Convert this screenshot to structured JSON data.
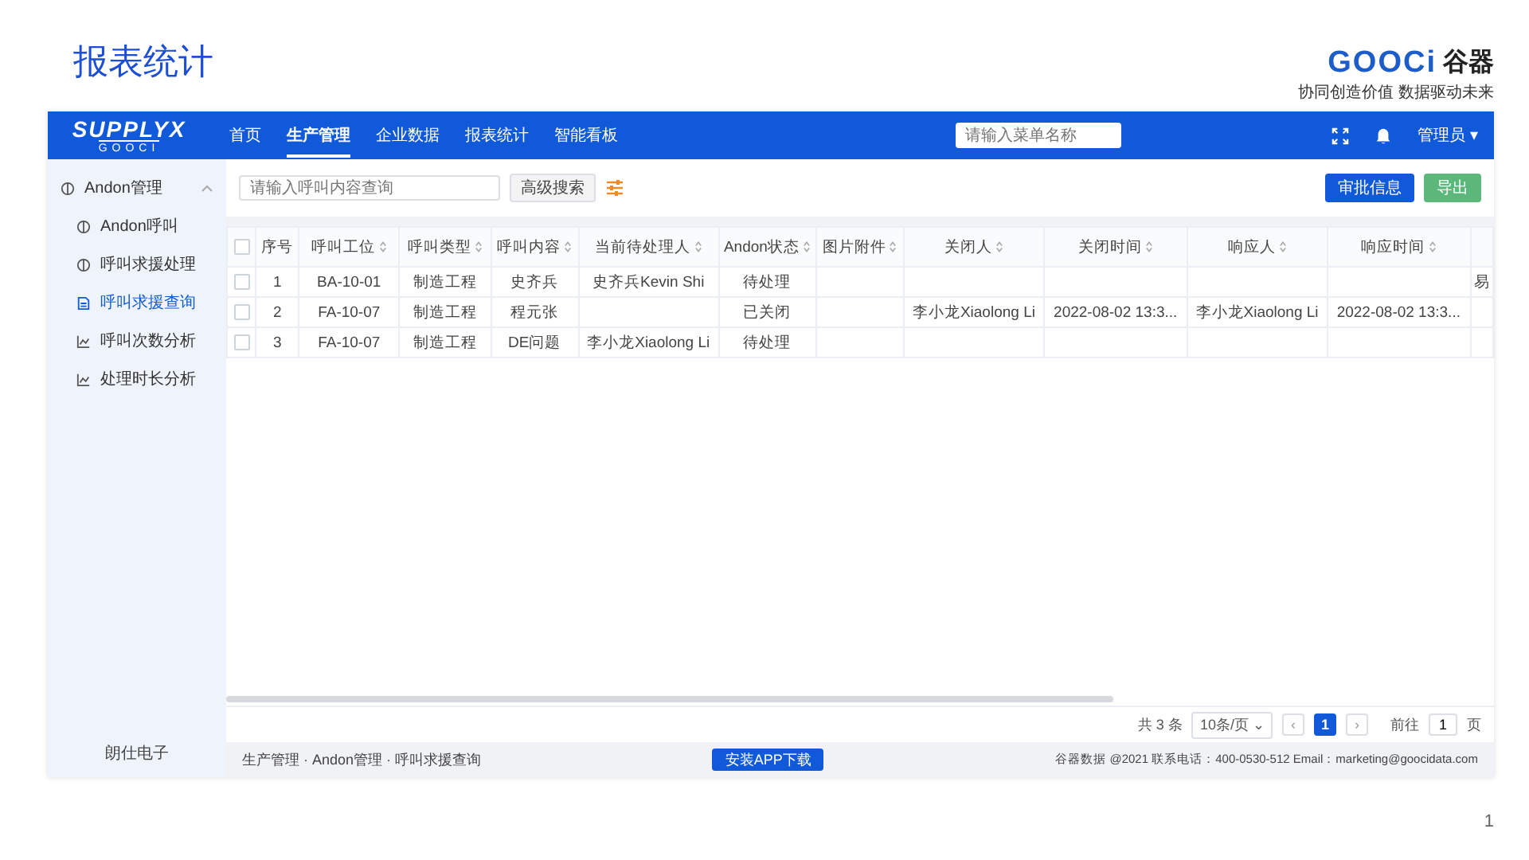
{
  "slide": {
    "title": "报表统计",
    "page_number": "1"
  },
  "logo": {
    "brand": "GOOCi",
    "brand_cn": "谷器",
    "tagline": "协同创造价值 数据驱动未来"
  },
  "app": {
    "topbar": {
      "logo_main": "SUPPLYX",
      "logo_sub": "GOOCI",
      "nav": [
        {
          "label": "首页",
          "selected": false
        },
        {
          "label": "生产管理",
          "selected": true
        },
        {
          "label": "企业数据",
          "selected": false
        },
        {
          "label": "报表统计",
          "selected": false
        },
        {
          "label": "智能看板",
          "selected": false
        }
      ],
      "search": {
        "placeholder": "请输入菜单名称"
      },
      "user": "管理员",
      "user_caret": "▾"
    },
    "sidebar": {
      "group": {
        "label": "Andon管理",
        "expanded": true,
        "children": [
          {
            "label": "Andon呼叫",
            "kind": "target",
            "selected": false
          },
          {
            "label": "呼叫求援处理",
            "kind": "target",
            "selected": false
          },
          {
            "label": "呼叫求援查询",
            "kind": "document",
            "selected": true
          },
          {
            "label": "呼叫次数分析",
            "kind": "chart",
            "selected": false
          },
          {
            "label": "处理时长分析",
            "kind": "chart",
            "selected": false
          }
        ]
      },
      "footer": "朗仕电子"
    },
    "toolbar": {
      "search": {
        "placeholder": "请输入呼叫内容查询"
      },
      "advanced": "高级搜索",
      "buttons": [
        {
          "label": "审批信息",
          "kind": "primary"
        },
        {
          "label": "导出",
          "kind": "success"
        }
      ]
    },
    "table": {
      "header_checked": false,
      "columns": [
        {
          "label": "序号",
          "sortable": false
        },
        {
          "label": "呼叫工位",
          "sortable": true
        },
        {
          "label": "呼叫类型",
          "sortable": true
        },
        {
          "label": "呼叫内容",
          "sortable": true
        },
        {
          "label": "当前待处理人",
          "sortable": true
        },
        {
          "label": "Andon状态",
          "sortable": true
        },
        {
          "label": "图片附件",
          "sortable": true
        },
        {
          "label": "关闭人",
          "sortable": true
        },
        {
          "label": "关闭时间",
          "sortable": true
        },
        {
          "label": "响应人",
          "sortable": true
        },
        {
          "label": "响应时间",
          "sortable": true
        },
        {
          "sortable": false
        }
      ],
      "rows": [
        {
          "checked": false,
          "cells": [
            "1",
            "BA-10-01",
            "制造工程",
            "史齐兵",
            "史齐兵Kevin Shi",
            "待处理",
            null,
            null,
            null,
            null,
            null,
            "易"
          ]
        },
        {
          "checked": false,
          "cells": [
            "2",
            "FA-10-07",
            "制造工程",
            "程元张",
            null,
            "已关闭",
            null,
            "李小龙Xiaolong Li",
            "2022-08-02 13:3...",
            "李小龙Xiaolong Li",
            "2022-08-02 13:3...",
            null
          ]
        },
        {
          "checked": false,
          "cells": [
            "3",
            "FA-10-07",
            "制造工程",
            "DE问题",
            "李小龙Xiaolong Li",
            "待处理",
            null,
            null,
            null,
            null,
            null,
            null
          ]
        }
      ]
    },
    "pagination": {
      "total": "共 3 条",
      "page_size": "10条/页",
      "page_size_caret": "⌄",
      "prev": "‹",
      "pages": [
        {
          "label": "1",
          "selected": true
        }
      ],
      "next": "›",
      "goto_label": "前往",
      "goto_value": "1",
      "page_unit": "页"
    },
    "footer": {
      "breadcrumb": "生产管理 · Andon管理 · 呼叫求援查询",
      "download": "安装APP下载",
      "copyright": "谷器数据 @2021 联系电话：400-0530-512 Email：marketing@goocidata.com"
    }
  }
}
